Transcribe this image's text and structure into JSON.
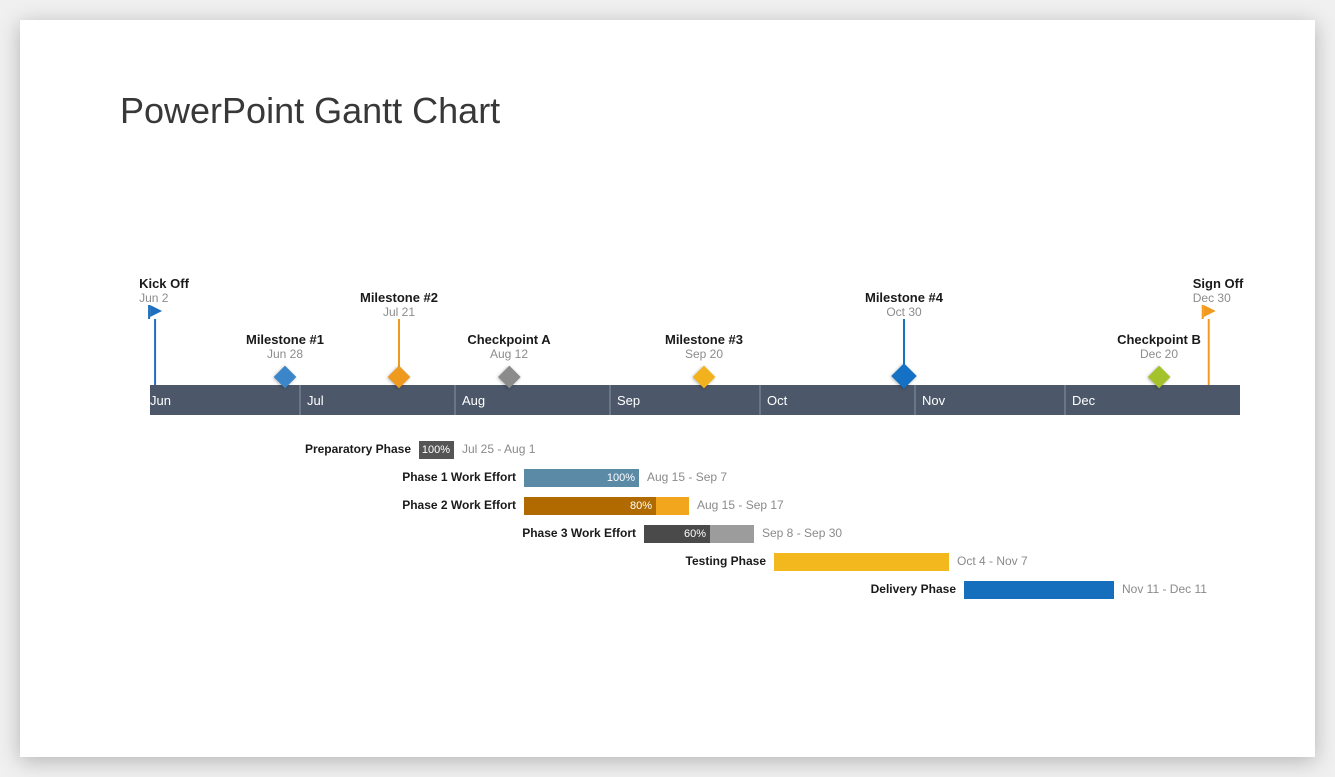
{
  "title": "PowerPoint Gantt Chart",
  "chart_data": {
    "type": "bar",
    "title": "PowerPoint Gantt Chart",
    "categories": [
      "Jun",
      "Jul",
      "Aug",
      "Sep",
      "Oct",
      "Nov",
      "Dec"
    ],
    "milestones": [
      {
        "name": "Kick Off",
        "date": "Jun 2",
        "shape": "flag",
        "color": "#1f6fc0",
        "tall": true
      },
      {
        "name": "Milestone #1",
        "date": "Jun 28",
        "shape": "diamond",
        "color": "#3a86c8",
        "tall": false
      },
      {
        "name": "Milestone #2",
        "date": "Jul 21",
        "shape": "diamond",
        "color": "#ed9a1f",
        "tall": true
      },
      {
        "name": "Checkpoint A",
        "date": "Aug 12",
        "shape": "diamond",
        "color": "#8b8b8b",
        "tall": false
      },
      {
        "name": "Milestone #3",
        "date": "Sep 20",
        "shape": "diamond",
        "color": "#f2b21d",
        "tall": false
      },
      {
        "name": "Milestone #4",
        "date": "Oct 30",
        "shape": "diamond",
        "color": "#1471c4",
        "tall": true
      },
      {
        "name": "Checkpoint B",
        "date": "Dec 20",
        "shape": "diamond",
        "color": "#a4c22b",
        "tall": false
      },
      {
        "name": "Sign Off",
        "date": "Dec 30",
        "shape": "flag",
        "color": "#f29a1f",
        "tall": true
      }
    ],
    "tasks": [
      {
        "name": "Preparatory Phase",
        "start": "Jul 25",
        "end": "Aug 1",
        "range": "Jul 25 - Aug 1",
        "progress": 100,
        "barColor": "#8a8a8a",
        "progColor": "#555555"
      },
      {
        "name": "Phase 1 Work Effort",
        "start": "Aug 15",
        "end": "Sep 7",
        "range": "Aug 15 - Sep 7",
        "progress": 100,
        "barColor": "#5b8aa6",
        "progColor": "#5b8aa6"
      },
      {
        "name": "Phase 2 Work Effort",
        "start": "Aug 15",
        "end": "Sep 17",
        "range": "Aug 15 - Sep 17",
        "progress": 80,
        "barColor": "#f2a61d",
        "progColor": "#b06a00"
      },
      {
        "name": "Phase 3 Work Effort",
        "start": "Sep 8",
        "end": "Sep 30",
        "range": "Sep 8 - Sep 30",
        "progress": 60,
        "barColor": "#9c9c9c",
        "progColor": "#4a4a4a"
      },
      {
        "name": "Testing Phase",
        "start": "Oct 4",
        "end": "Nov 7",
        "range": "Oct 4 - Nov 7",
        "progress": 0,
        "barColor": "#f4b81f",
        "progColor": "#f4b81f"
      },
      {
        "name": "Delivery Phase",
        "start": "Nov 11",
        "end": "Dec 11",
        "range": "Nov 11 - Dec 11",
        "progress": 0,
        "barColor": "#156fbd",
        "progColor": "#156fbd"
      }
    ],
    "xlabel": "",
    "ylabel": ""
  }
}
